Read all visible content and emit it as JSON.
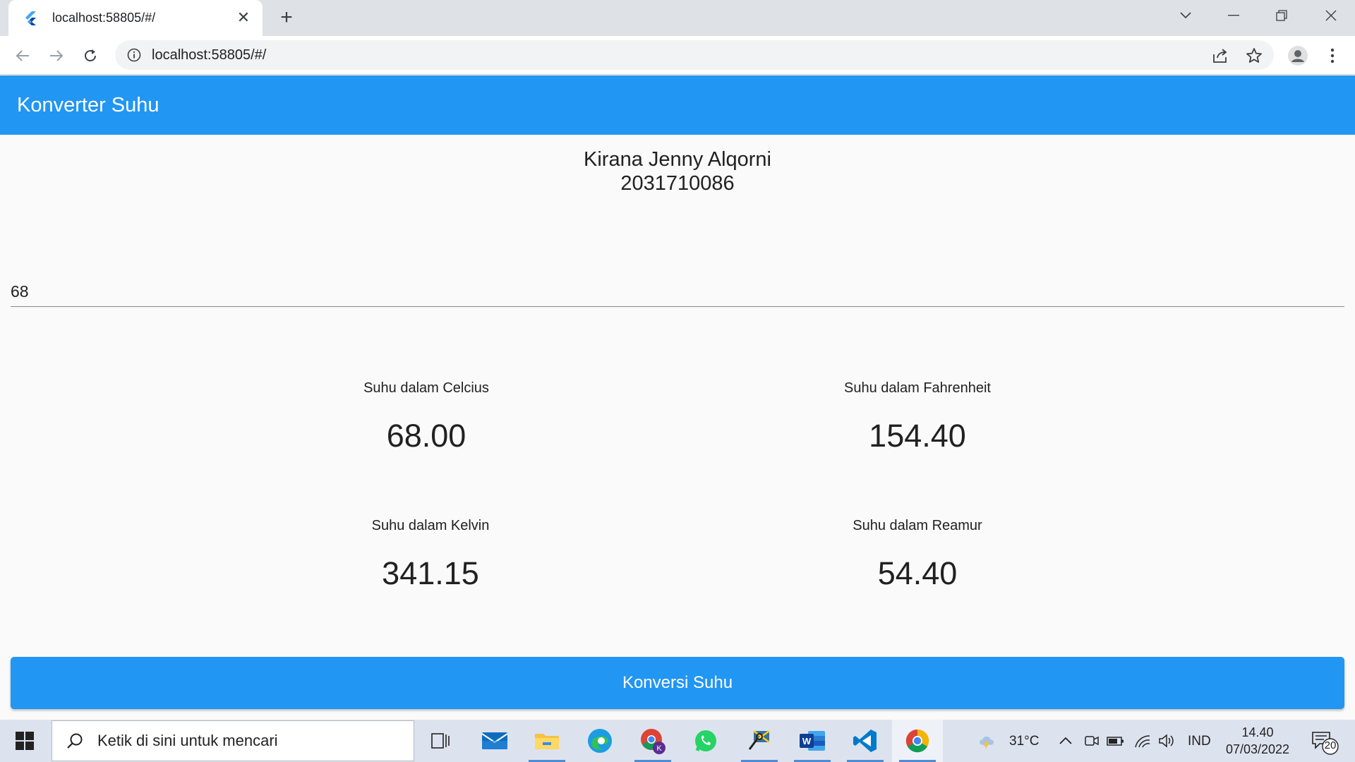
{
  "browser": {
    "tab_title": "localhost:58805/#/",
    "url": "localhost:58805/#/"
  },
  "app": {
    "title": "Konverter Suhu",
    "student_name": "Kirana Jenny Alqorni",
    "student_id": "2031710086",
    "input_value": "68",
    "results": {
      "celcius": {
        "label": "Suhu dalam Celcius",
        "value": "68.00"
      },
      "fahrenheit": {
        "label": "Suhu dalam Fahrenheit",
        "value": "154.40"
      },
      "kelvin": {
        "label": "Suhu dalam Kelvin",
        "value": "341.15"
      },
      "reamur": {
        "label": "Suhu dalam Reamur",
        "value": "54.40"
      }
    },
    "convert_button": "Konversi Suhu",
    "accent_color": "#2196f3"
  },
  "taskbar": {
    "search_placeholder": "Ketik di sini untuk mencari",
    "weather": "31°C",
    "language": "IND",
    "time": "14.40",
    "date": "07/03/2022",
    "notification_count": "20",
    "apps": [
      "task-view",
      "mail",
      "file-explorer",
      "edge",
      "chrome-profile",
      "whatsapp",
      "app-tool",
      "word",
      "vscode",
      "chrome"
    ]
  }
}
